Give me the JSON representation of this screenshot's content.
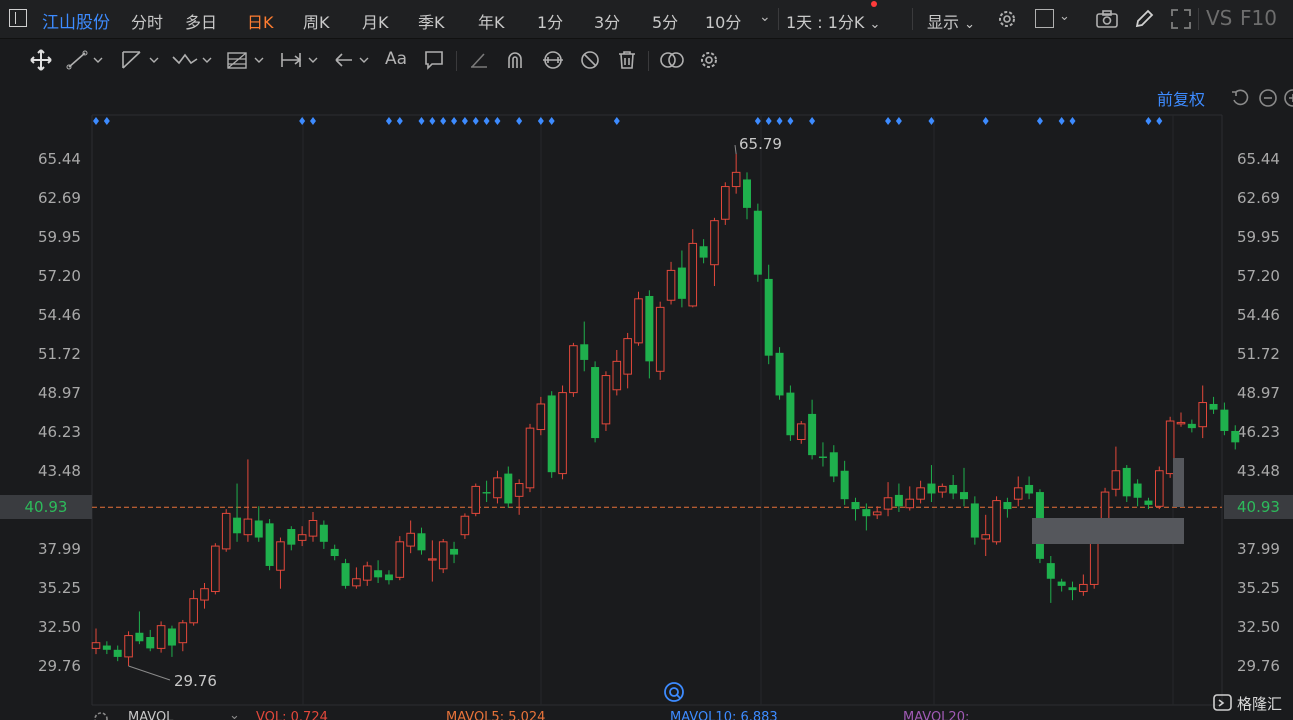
{
  "header": {
    "stock_name": "江山股份",
    "tabs": [
      {
        "label": "分时",
        "active": false
      },
      {
        "label": "多日",
        "active": false
      },
      {
        "label": "日K",
        "active": true
      },
      {
        "label": "周K",
        "active": false
      },
      {
        "label": "月K",
        "active": false
      },
      {
        "label": "季K",
        "active": false
      },
      {
        "label": "年K",
        "active": false
      },
      {
        "label": "1分",
        "active": false
      },
      {
        "label": "3分",
        "active": false
      },
      {
        "label": "5分",
        "active": false
      },
      {
        "label": "10分",
        "active": false
      }
    ],
    "period_select": "1天 : 1分K",
    "display_label": "显示",
    "vs_label": "VS",
    "f10_label": "F10"
  },
  "toolbar": {
    "text_tool_label": "Aa"
  },
  "chart": {
    "adjust_label": "前复权",
    "y_ticks": [
      "65.44",
      "62.69",
      "59.95",
      "57.20",
      "54.46",
      "51.72",
      "48.97",
      "46.23",
      "43.48",
      "40.93",
      "37.99",
      "35.25",
      "32.50",
      "29.76"
    ],
    "current_price": "40.93",
    "max_label": "65.79",
    "min_label": "29.76",
    "colors": {
      "up": "#e2483b",
      "down": "#1fb04d",
      "accent": "#3d8bff",
      "price_line": "#e8733a"
    }
  },
  "chart_data": {
    "type": "candlestick",
    "ylim": [
      28.5,
      67.5
    ],
    "y_ticks": [
      65.44,
      62.69,
      59.95,
      57.2,
      54.46,
      51.72,
      48.97,
      46.23,
      43.48,
      40.93,
      37.99,
      35.25,
      32.5,
      29.76
    ],
    "max": 65.79,
    "min": 29.76,
    "current": 40.93,
    "candles": [
      [
        31.0,
        31.4,
        30.6,
        32.4
      ],
      [
        31.2,
        30.9,
        30.6,
        31.5
      ],
      [
        30.9,
        30.4,
        30.1,
        31.2
      ],
      [
        30.4,
        31.9,
        29.76,
        32.2
      ],
      [
        32.1,
        31.5,
        31.3,
        33.6
      ],
      [
        31.8,
        31.0,
        30.8,
        32.3
      ],
      [
        31.0,
        32.6,
        30.7,
        32.9
      ],
      [
        32.4,
        31.2,
        30.4,
        32.6
      ],
      [
        31.4,
        32.8,
        30.8,
        33.0
      ],
      [
        32.8,
        34.5,
        32.6,
        35.1
      ],
      [
        34.4,
        35.2,
        33.8,
        35.6
      ],
      [
        35.0,
        38.2,
        34.8,
        38.4
      ],
      [
        38.0,
        40.5,
        37.8,
        40.8
      ],
      [
        40.2,
        39.1,
        38.5,
        42.6
      ],
      [
        39.0,
        40.1,
        38.5,
        44.3
      ],
      [
        40.0,
        38.8,
        38.5,
        41.0
      ],
      [
        39.8,
        36.8,
        36.5,
        40.1
      ],
      [
        36.5,
        38.5,
        35.2,
        38.8
      ],
      [
        39.4,
        38.3,
        37.9,
        39.6
      ],
      [
        38.6,
        39.0,
        38.2,
        39.6
      ],
      [
        38.9,
        40.0,
        38.5,
        40.6
      ],
      [
        39.7,
        38.5,
        38.0,
        40.0
      ],
      [
        38.0,
        37.5,
        37.2,
        38.3
      ],
      [
        37.0,
        35.4,
        35.2,
        37.3
      ],
      [
        35.4,
        35.9,
        35.2,
        36.7
      ],
      [
        35.8,
        36.8,
        35.4,
        37.1
      ],
      [
        36.5,
        36.0,
        35.6,
        37.2
      ],
      [
        36.2,
        35.8,
        35.5,
        36.5
      ],
      [
        36.0,
        38.5,
        35.8,
        38.9
      ],
      [
        38.2,
        39.1,
        37.7,
        40.0
      ],
      [
        39.1,
        37.9,
        37.6,
        39.5
      ],
      [
        37.3,
        37.3,
        35.7,
        38.6
      ],
      [
        36.6,
        38.5,
        36.3,
        38.7
      ],
      [
        38.0,
        37.6,
        37.0,
        38.5
      ],
      [
        39.0,
        40.3,
        38.7,
        40.5
      ],
      [
        40.5,
        42.4,
        40.3,
        42.6
      ],
      [
        42.0,
        41.9,
        41.3,
        42.8
      ],
      [
        41.6,
        43.0,
        41.2,
        43.5
      ],
      [
        43.3,
        41.2,
        40.9,
        43.8
      ],
      [
        41.7,
        42.6,
        40.4,
        42.9
      ],
      [
        42.3,
        46.5,
        42.0,
        46.8
      ],
      [
        46.4,
        48.2,
        46.0,
        48.7
      ],
      [
        48.8,
        43.4,
        43.0,
        49.1
      ],
      [
        43.3,
        49.0,
        42.9,
        49.5
      ],
      [
        49.0,
        52.3,
        48.7,
        52.5
      ],
      [
        52.4,
        51.3,
        50.5,
        54.0
      ],
      [
        50.8,
        45.8,
        45.5,
        51.2
      ],
      [
        46.8,
        50.2,
        46.3,
        50.5
      ],
      [
        49.2,
        51.2,
        48.8,
        52.0
      ],
      [
        50.3,
        52.8,
        49.3,
        53.2
      ],
      [
        52.5,
        55.6,
        52.3,
        56.1
      ],
      [
        55.8,
        51.2,
        50.0,
        56.2
      ],
      [
        50.5,
        55.0,
        49.9,
        55.4
      ],
      [
        55.5,
        57.6,
        55.2,
        58.2
      ],
      [
        57.8,
        55.6,
        55.0,
        59.0
      ],
      [
        55.1,
        59.5,
        55.0,
        60.5
      ],
      [
        59.3,
        58.5,
        58.1,
        59.8
      ],
      [
        58.0,
        61.1,
        56.5,
        61.3
      ],
      [
        61.2,
        63.5,
        60.8,
        63.8
      ],
      [
        63.5,
        64.5,
        63.0,
        65.79
      ],
      [
        64.0,
        62.0,
        61.2,
        64.5
      ],
      [
        61.8,
        57.3,
        56.8,
        62.3
      ],
      [
        57.0,
        51.6,
        51.0,
        58.0
      ],
      [
        51.8,
        48.8,
        48.5,
        52.2
      ],
      [
        49.0,
        46.0,
        45.6,
        49.5
      ],
      [
        45.7,
        46.8,
        45.4,
        47.0
      ],
      [
        47.5,
        44.6,
        44.3,
        48.5
      ],
      [
        44.5,
        44.4,
        43.8,
        45.5
      ],
      [
        44.8,
        43.1,
        42.7,
        45.3
      ],
      [
        43.5,
        41.5,
        41.1,
        44.2
      ],
      [
        41.3,
        40.8,
        40.0,
        41.6
      ],
      [
        40.8,
        40.3,
        39.3,
        41.2
      ],
      [
        40.4,
        40.6,
        40.1,
        41.0
      ],
      [
        40.8,
        41.6,
        40.3,
        42.7
      ],
      [
        41.8,
        41.0,
        40.6,
        42.6
      ],
      [
        40.9,
        41.5,
        40.7,
        42.4
      ],
      [
        41.5,
        42.3,
        41.2,
        42.8
      ],
      [
        42.6,
        41.9,
        41.3,
        43.9
      ],
      [
        42.0,
        42.4,
        41.6,
        42.6
      ],
      [
        42.5,
        41.9,
        41.5,
        43.2
      ],
      [
        42.0,
        41.5,
        41.0,
        43.7
      ],
      [
        41.2,
        38.8,
        38.3,
        41.7
      ],
      [
        38.7,
        39.0,
        37.5,
        40.4
      ],
      [
        38.5,
        41.4,
        38.3,
        41.7
      ],
      [
        41.3,
        40.8,
        40.2,
        41.6
      ],
      [
        41.5,
        42.3,
        41.0,
        43.1
      ],
      [
        42.5,
        41.9,
        41.5,
        43.1
      ],
      [
        42.0,
        37.3,
        37.0,
        42.2
      ],
      [
        37.0,
        35.9,
        34.2,
        37.5
      ],
      [
        35.7,
        35.4,
        35.0,
        35.9
      ],
      [
        35.3,
        35.1,
        34.4,
        35.7
      ],
      [
        35.0,
        35.5,
        34.7,
        36.2
      ],
      [
        35.5,
        38.6,
        35.2,
        38.9
      ],
      [
        39.1,
        42.0,
        38.9,
        42.3
      ],
      [
        42.2,
        43.5,
        41.7,
        45.2
      ],
      [
        43.7,
        41.7,
        41.3,
        43.9
      ],
      [
        42.6,
        41.6,
        41.0,
        42.9
      ],
      [
        41.4,
        41.1,
        40.8,
        41.6
      ],
      [
        41.0,
        43.5,
        40.8,
        43.8
      ],
      [
        43.3,
        47.0,
        43.0,
        47.3
      ],
      [
        46.8,
        46.9,
        46.6,
        47.6
      ],
      [
        46.8,
        46.5,
        46.2,
        47.1
      ],
      [
        46.6,
        48.3,
        45.8,
        49.5
      ],
      [
        48.2,
        47.8,
        47.5,
        48.7
      ],
      [
        47.8,
        46.3,
        46.0,
        48.3
      ],
      [
        46.3,
        45.5,
        45.0,
        46.7
      ]
    ],
    "event_marker_groups": [
      [
        0,
        1
      ],
      [
        19,
        20
      ],
      [
        27,
        28
      ],
      [
        30,
        31,
        32,
        33,
        34,
        35,
        36,
        37
      ],
      [
        39
      ],
      [
        41,
        42
      ],
      [
        48
      ],
      [
        61,
        62,
        63,
        64
      ],
      [
        66
      ],
      [
        73,
        74
      ],
      [
        77
      ],
      [
        82
      ],
      [
        87
      ],
      [
        89,
        90
      ],
      [
        97,
        98
      ]
    ]
  },
  "bottom_bar": {
    "mavol_label": "MAVOL",
    "vol_label": "VOL: 0.724",
    "mavol5_label": "MAVOL5: 5.024",
    "mavol10_label": "MAVOL10: 6.883",
    "mavol20_label": "MAVOL20:"
  },
  "watermark": "格隆汇"
}
